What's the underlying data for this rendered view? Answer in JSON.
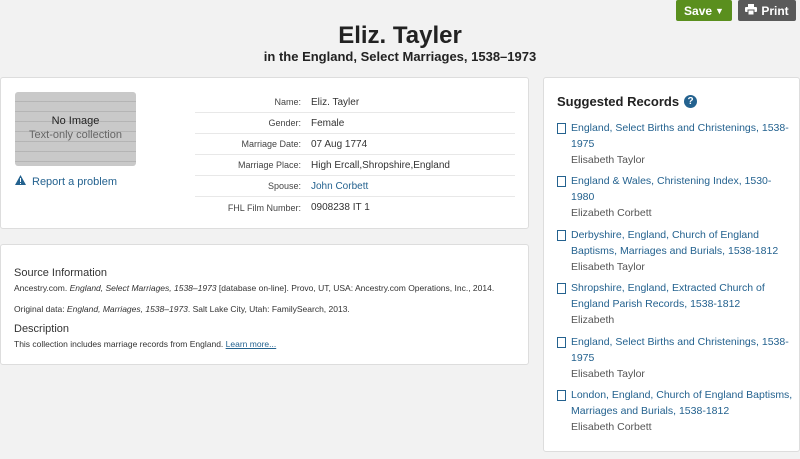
{
  "toolbar": {
    "save_label": "Save",
    "print_label": "Print"
  },
  "header": {
    "title": "Eliz. Tayler",
    "subtitle": "in the England, Select Marriages, 1538–1973"
  },
  "image": {
    "no_image": "No Image",
    "text_only": "Text-only collection"
  },
  "report_link": "Report a problem",
  "fields": [
    {
      "label": "Name:",
      "value": "Eliz. Tayler"
    },
    {
      "label": "Gender:",
      "value": "Female"
    },
    {
      "label": "Marriage Date:",
      "value": "07 Aug 1774"
    },
    {
      "label": "Marriage Place:",
      "value": "High Ercall,Shropshire,England"
    },
    {
      "label": "Spouse:",
      "value": "John Corbett"
    },
    {
      "label": "FHL Film Number:",
      "value": "0908238 IT 1"
    }
  ],
  "source": {
    "heading": "Source Information",
    "line1_a": "Ancestry.com. ",
    "line1_b": "England, Select Marriages, 1538–1973",
    "line1_c": " [database on-line]. Provo, UT, USA: Ancestry.com Operations, Inc., 2014.",
    "line2_a": "Original data: ",
    "line2_b": "England, Marriages, 1538–1973",
    "line2_c": ". Salt Lake City, Utah: FamilySearch, 2013.",
    "desc_heading": "Description",
    "desc_text": "This collection includes marriage records from England. ",
    "learn_more": "Learn more..."
  },
  "suggested": {
    "heading": "Suggested Records",
    "items": [
      {
        "title": "England, Select Births and Christenings, 1538-1975",
        "name": "Elisabeth Taylor"
      },
      {
        "title": "England & Wales, Christening Index, 1530-1980",
        "name": "Elizabeth Corbett"
      },
      {
        "title": "Derbyshire, England, Church of England Baptisms, Marriages and Burials, 1538-1812",
        "name": "Elisabeth Taylor"
      },
      {
        "title": "Shropshire, England, Extracted Church of England Parish Records, 1538-1812",
        "name": "Elizabeth"
      },
      {
        "title": "England, Select Births and Christenings, 1538-1975",
        "name": "Elisabeth Taylor"
      },
      {
        "title": "London, England, Church of England Baptisms, Marriages and Burials, 1538-1812",
        "name": "Elisabeth Corbett"
      }
    ]
  }
}
